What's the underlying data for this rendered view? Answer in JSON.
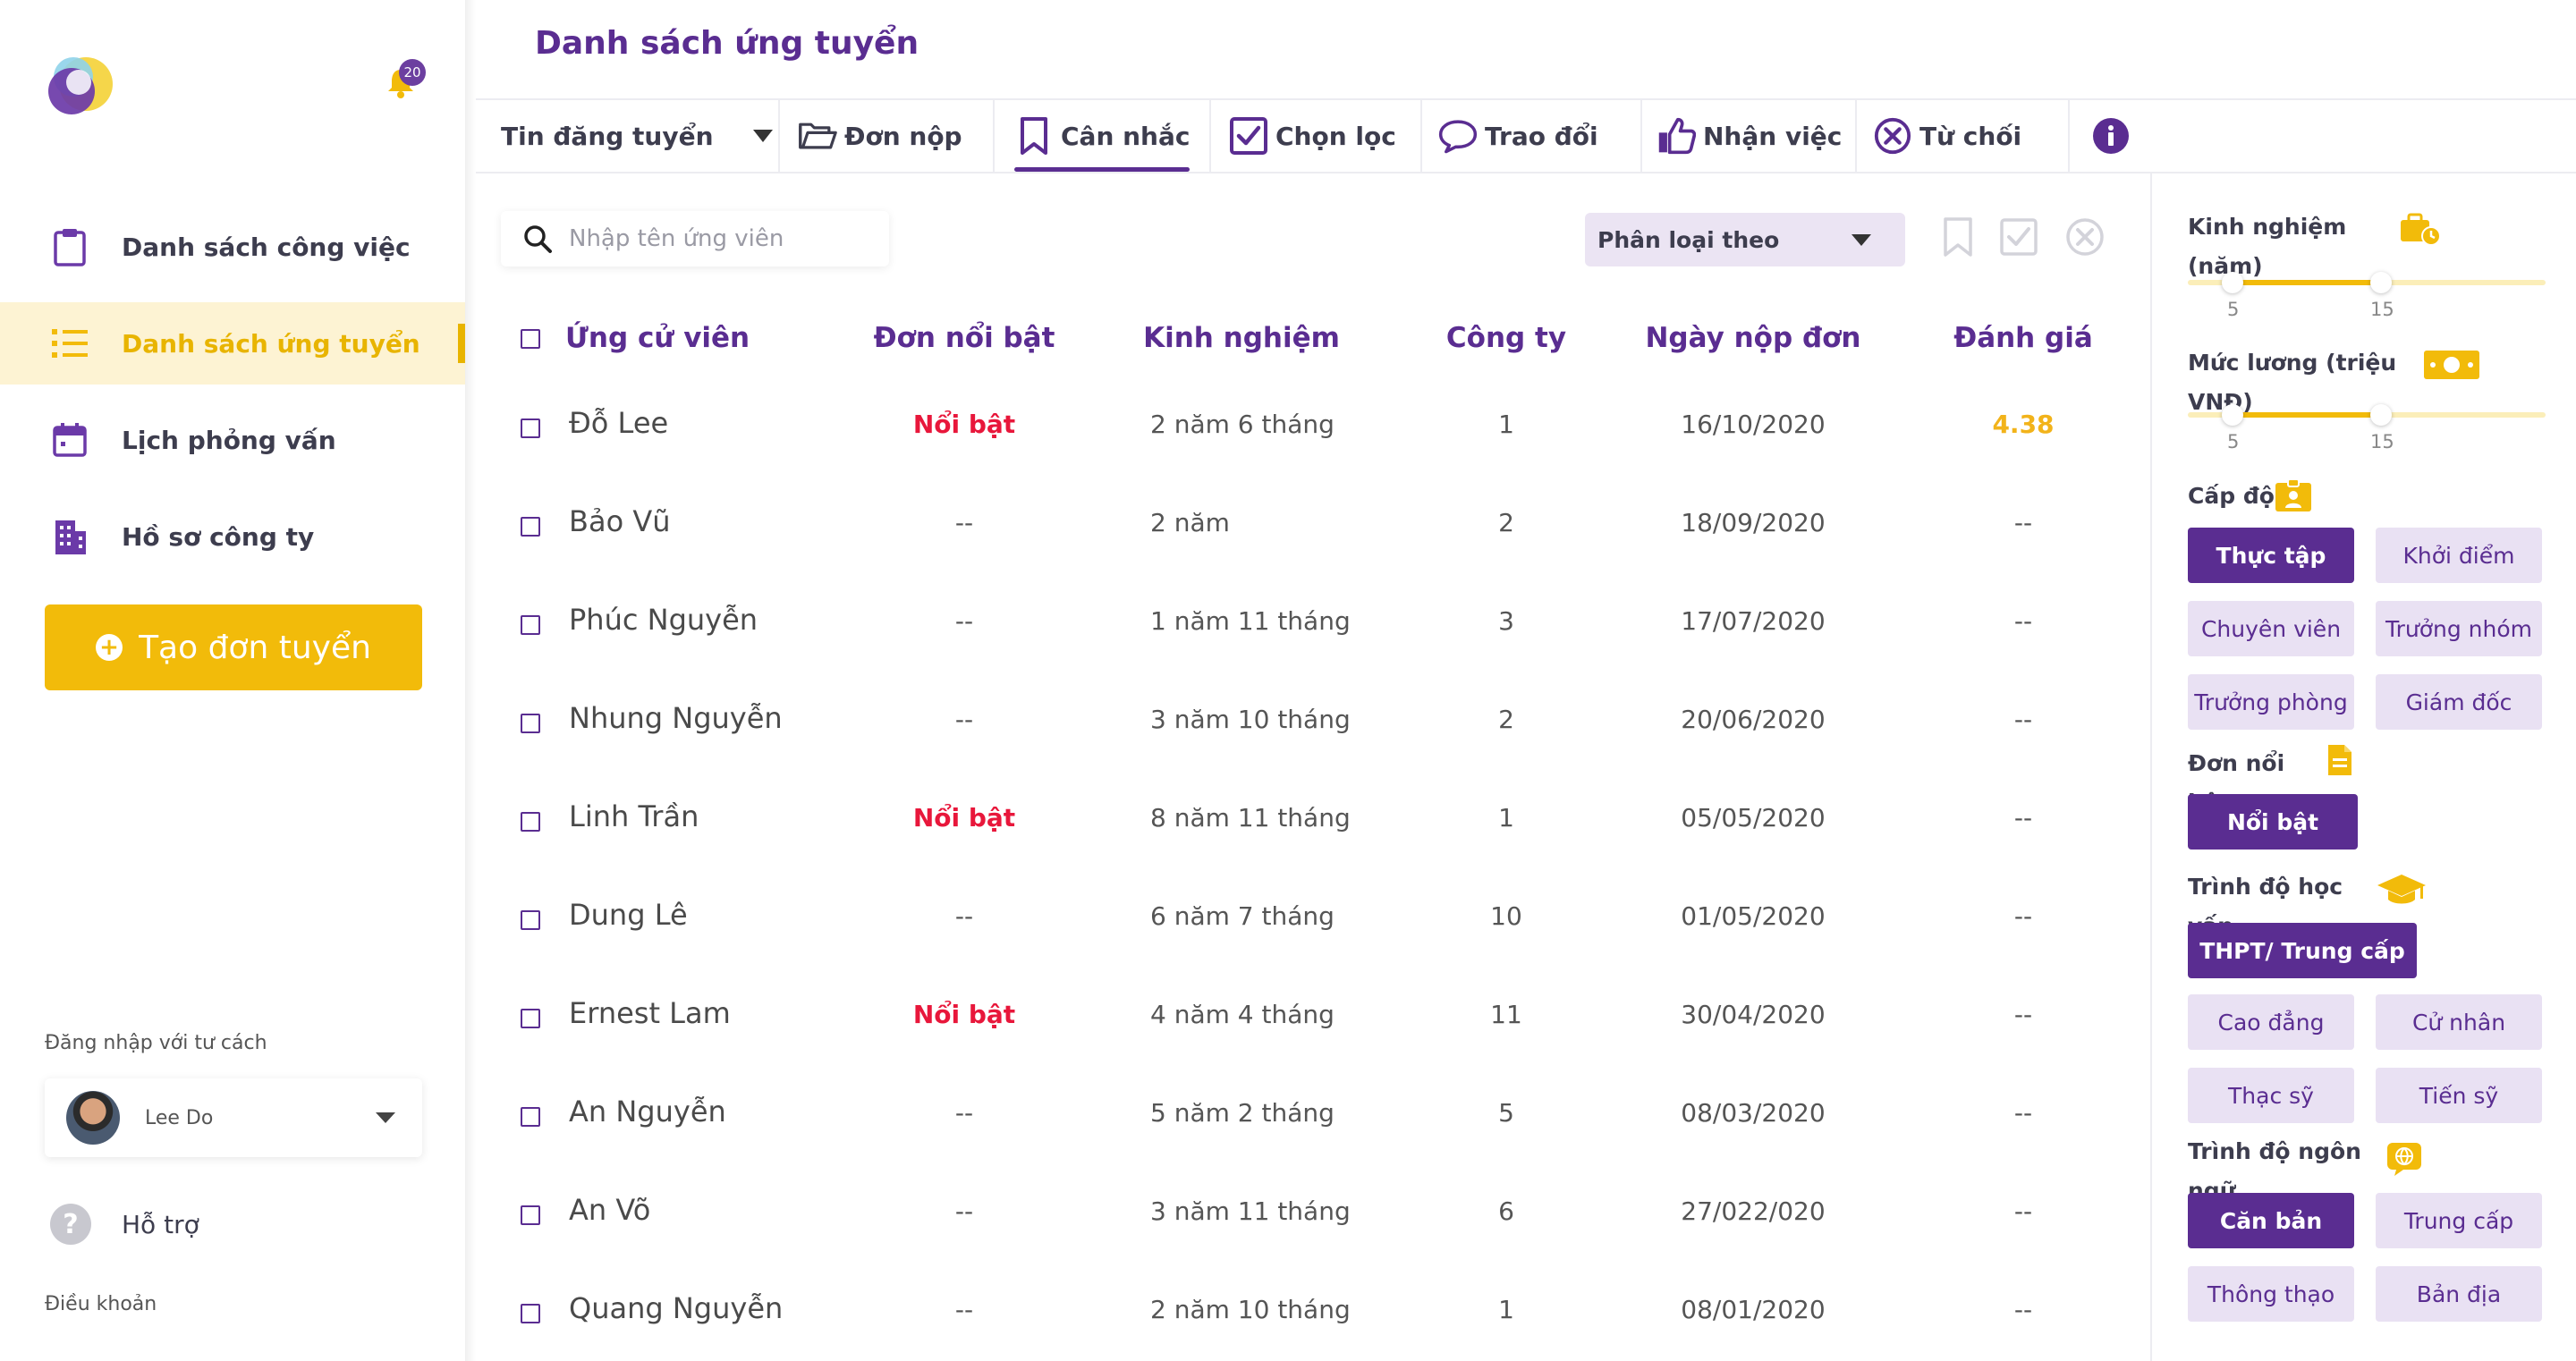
{
  "app": {
    "page_title": "Danh sách ứng tuyển",
    "notification_count": "20"
  },
  "sidebar": {
    "items": [
      {
        "label": "Danh sách công việc",
        "icon": "clipboard-icon"
      },
      {
        "label": "Danh sách ứng tuyển",
        "icon": "list-icon",
        "active": true
      },
      {
        "label": "Lịch phỏng vấn",
        "icon": "calendar-icon"
      },
      {
        "label": "Hồ sơ công ty",
        "icon": "building-icon"
      }
    ],
    "create_button": "Tạo đơn tuyển",
    "login_as_label": "Đăng nhập với tư cách",
    "user_name": "Lee Do",
    "support_label": "Hỗ trợ",
    "terms_label": "Điều khoản"
  },
  "tabs": [
    {
      "label": "Tin đăng tuyển",
      "icon": "chevron-down-icon"
    },
    {
      "label": "Đơn nộp",
      "icon": "folder-icon"
    },
    {
      "label": "Cân nhắc",
      "icon": "bookmark-icon",
      "active": true
    },
    {
      "label": "Chọn lọc",
      "icon": "checkbox-icon"
    },
    {
      "label": "Trao đổi",
      "icon": "chat-icon"
    },
    {
      "label": "Nhận việc",
      "icon": "thumbs-up-icon"
    },
    {
      "label": "Từ chối",
      "icon": "close-circle-icon"
    },
    {
      "label": "",
      "icon": "info-icon"
    }
  ],
  "toolbar": {
    "search_placeholder": "Nhập tên ứng viên",
    "sort_label": "Phân loại theo"
  },
  "table": {
    "columns": [
      "Ứng cử viên",
      "Đơn nổi bật",
      "Kinh nghiệm",
      "Công ty",
      "Ngày nộp đơn",
      "Đánh giá"
    ],
    "rows": [
      {
        "name": "Đỗ Lee",
        "featured": "Nổi bật",
        "experience": "2 năm 6 tháng",
        "companies": "1",
        "date": "16/10/2020",
        "rating": "4.38"
      },
      {
        "name": "Bảo Vũ",
        "featured": "--",
        "experience": "2 năm",
        "companies": "2",
        "date": "18/09/2020",
        "rating": "--"
      },
      {
        "name": "Phúc Nguyễn",
        "featured": "--",
        "experience": "1 năm 11 tháng",
        "companies": "3",
        "date": "17/07/2020",
        "rating": "--"
      },
      {
        "name": "Nhung Nguyễn",
        "featured": "--",
        "experience": "3 năm 10 tháng",
        "companies": "2",
        "date": "20/06/2020",
        "rating": "--"
      },
      {
        "name": "Linh Trần",
        "featured": "Nổi bật",
        "experience": "8 năm 11 tháng",
        "companies": "1",
        "date": "05/05/2020",
        "rating": "--"
      },
      {
        "name": "Dung Lê",
        "featured": "--",
        "experience": "6 năm 7 tháng",
        "companies": "10",
        "date": "01/05/2020",
        "rating": "--"
      },
      {
        "name": "Ernest Lam",
        "featured": "Nổi bật",
        "experience": "4 năm 4 tháng",
        "companies": "11",
        "date": "30/04/2020",
        "rating": "--"
      },
      {
        "name": "An Nguyễn",
        "featured": "--",
        "experience": "5 năm 2 tháng",
        "companies": "5",
        "date": "08/03/2020",
        "rating": "--"
      },
      {
        "name": "An Võ",
        "featured": "--",
        "experience": "3 năm 11 tháng",
        "companies": "6",
        "date": "27/022/020",
        "rating": "--"
      },
      {
        "name": "Quang Nguyễn",
        "featured": "--",
        "experience": "2 năm 10 tháng",
        "companies": "1",
        "date": "08/01/2020",
        "rating": "--"
      }
    ]
  },
  "filters": {
    "experience": {
      "label": "Kinh nghiệm (năm)",
      "min": "5",
      "max": "15",
      "range": [
        5,
        15
      ]
    },
    "salary": {
      "label": "Mức lương (triệu VNĐ)",
      "min": "5",
      "max": "15",
      "range": [
        5,
        15
      ]
    },
    "level": {
      "label": "Cấp độ",
      "options": [
        {
          "label": "Thực tập",
          "selected": true
        },
        {
          "label": "Khởi điểm",
          "selected": false
        },
        {
          "label": "Chuyên viên",
          "selected": false
        },
        {
          "label": "Trưởng nhóm",
          "selected": false
        },
        {
          "label": "Trưởng phòng",
          "selected": false
        },
        {
          "label": "Giám đốc",
          "selected": false
        }
      ]
    },
    "featured": {
      "label": "Đơn nổi bật",
      "options": [
        {
          "label": "Nổi bật",
          "selected": true
        }
      ]
    },
    "education": {
      "label": "Trình độ học vấn",
      "options": [
        {
          "label": "THPT/ Trung cấp",
          "selected": true
        },
        {
          "label": "Cao đẳng",
          "selected": false
        },
        {
          "label": "Cử nhân",
          "selected": false
        },
        {
          "label": "Thạc sỹ",
          "selected": false
        },
        {
          "label": "Tiến sỹ",
          "selected": false
        }
      ]
    },
    "language": {
      "label": "Trình độ ngôn ngữ",
      "options": [
        {
          "label": "Căn bản",
          "selected": true
        },
        {
          "label": "Trung cấp",
          "selected": false
        },
        {
          "label": "Thông thạo",
          "selected": false
        },
        {
          "label": "Bản địa",
          "selected": false
        }
      ]
    }
  },
  "colors": {
    "primary": "#5a2d91",
    "accent": "#f2bb0a",
    "featured_text": "#e8173b",
    "chip_bg": "#e9e1f3"
  }
}
